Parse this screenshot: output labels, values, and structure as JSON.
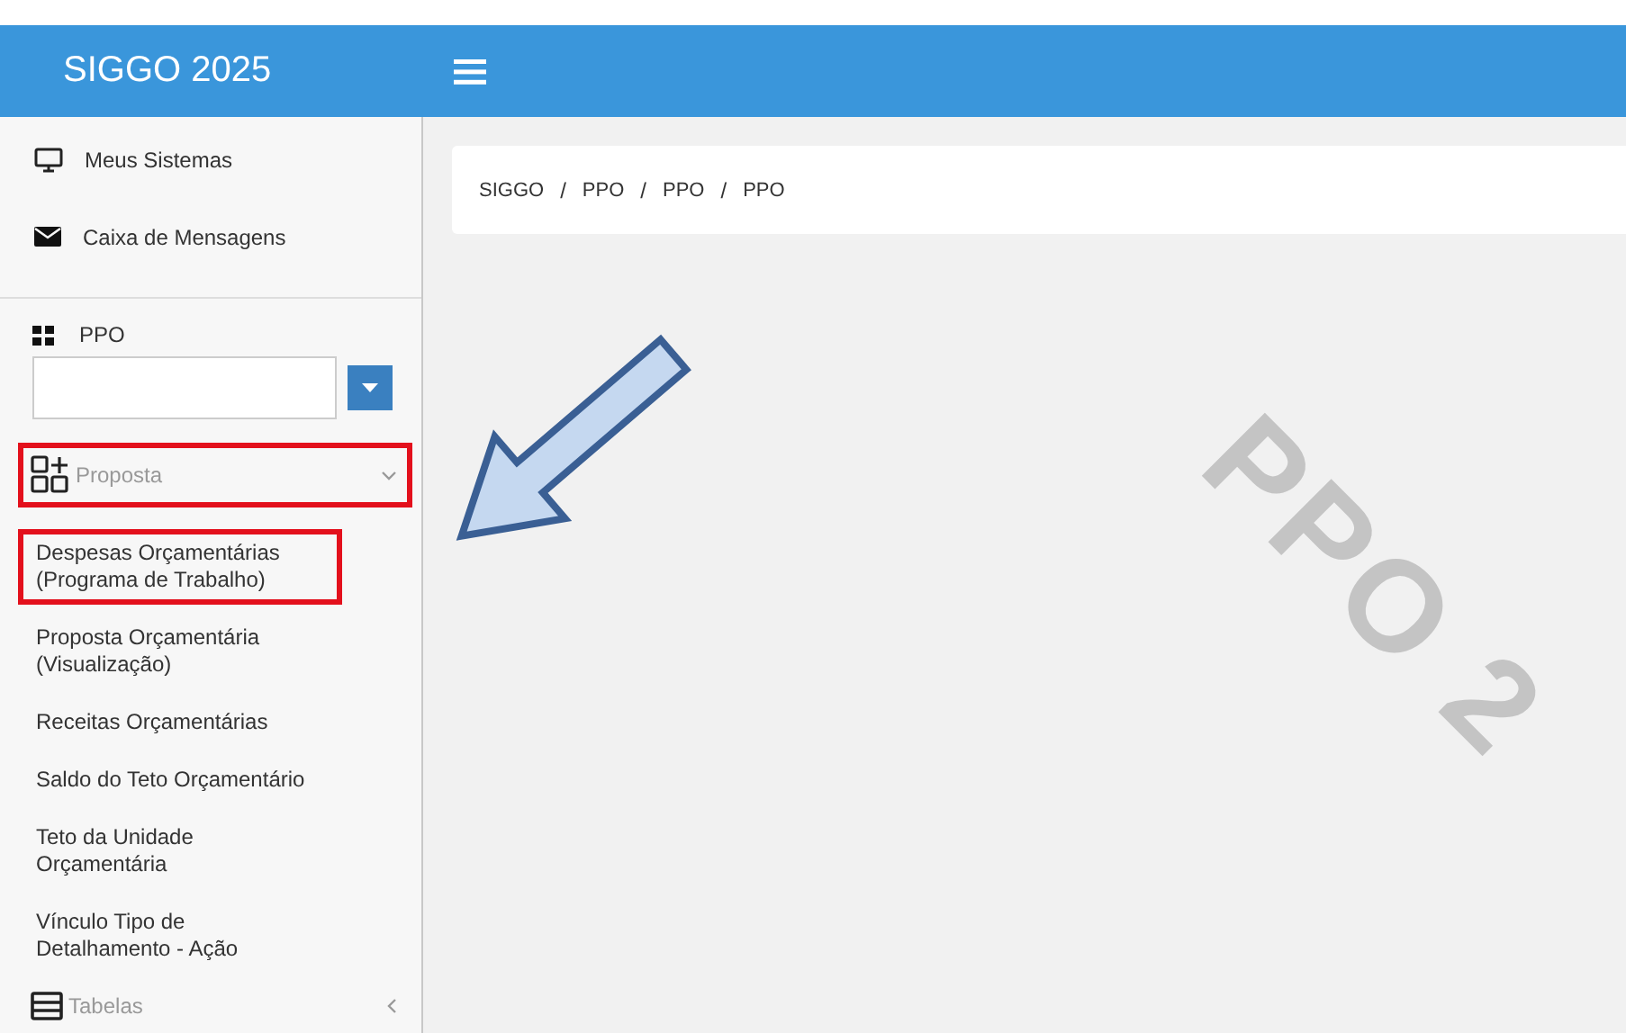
{
  "header": {
    "title": "SIGGO 2025"
  },
  "sidebar": {
    "links": [
      {
        "label": "Meus Sistemas"
      },
      {
        "label": "Caixa de Mensagens"
      }
    ],
    "module": {
      "label": "PPO"
    },
    "menu": [
      {
        "label": "Proposta",
        "expanded": true,
        "highlighted": true,
        "children": [
          {
            "label": "Despesas Orçamentárias (Programa de Trabalho)",
            "highlighted": true
          },
          {
            "label": "Proposta Orçamentária (Visualização)",
            "highlighted": false
          },
          {
            "label": "Receitas Orçamentárias",
            "highlighted": false
          },
          {
            "label": "Saldo do Teto Orçamentário",
            "highlighted": false
          },
          {
            "label": "Teto da Unidade Orçamentária",
            "highlighted": false
          },
          {
            "label": "Vínculo Tipo de Detalhamento - Ação",
            "highlighted": false
          }
        ]
      },
      {
        "label": "Tabelas",
        "expanded": false,
        "highlighted": false
      }
    ]
  },
  "breadcrumb": {
    "separator": "/",
    "items": [
      "SIGGO",
      "PPO",
      "PPO",
      "PPO"
    ]
  },
  "background_label": "PPO 2"
}
